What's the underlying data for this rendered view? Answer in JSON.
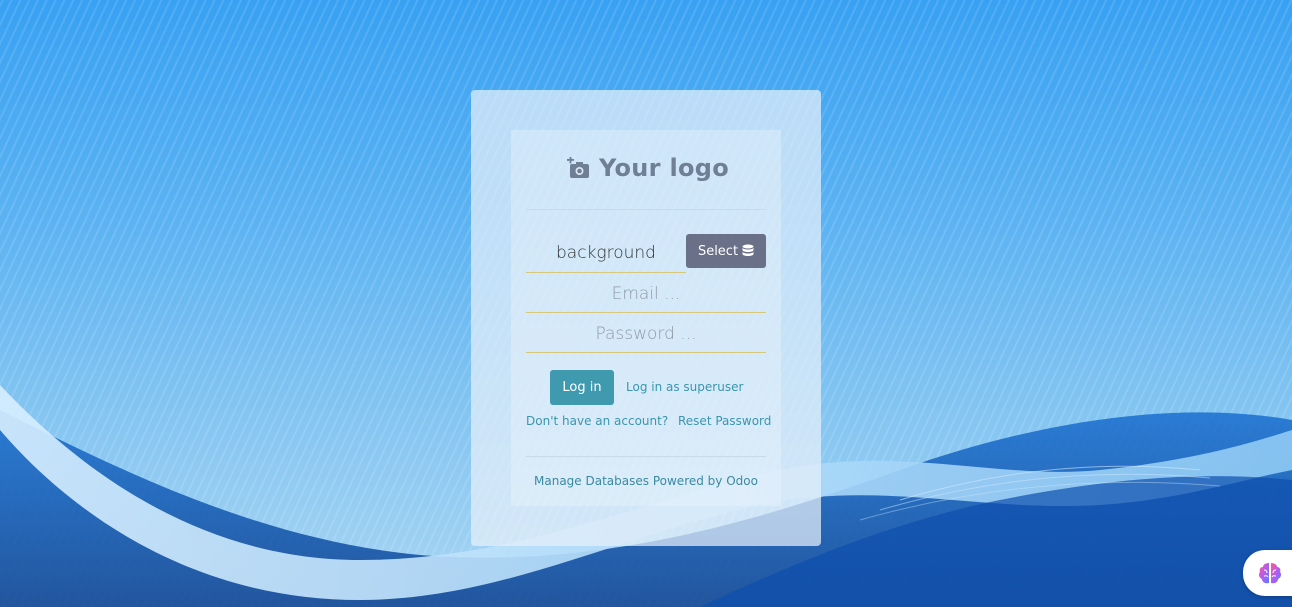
{
  "logo": {
    "text": "Your logo",
    "icon": "add-camera-icon"
  },
  "database": {
    "value": "background",
    "select_label": "Select",
    "select_icon": "database-icon"
  },
  "login_form": {
    "email_placeholder": "Email ...",
    "password_placeholder": "Password ...",
    "login_label": "Log in",
    "superuser_label": "Log in as superuser",
    "signup_label": "Don't have an account?",
    "reset_label": "Reset Password"
  },
  "footer": {
    "manage_label": "Manage Databases",
    "powered_label": "Powered by",
    "odoo_label": "Odoo"
  },
  "colors": {
    "primary": "#3f9ab0",
    "select_button": "#6a7088",
    "link": "#3a96ad",
    "field_underline": "#d9c77a"
  },
  "floating_button": {
    "icon": "brain-icon"
  }
}
